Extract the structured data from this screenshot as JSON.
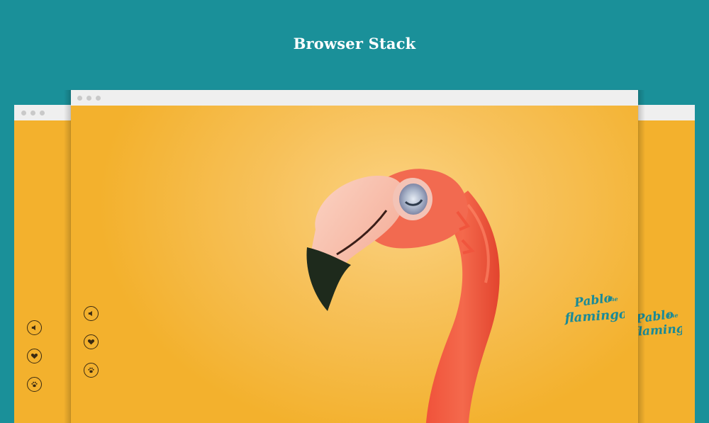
{
  "page": {
    "title": "Browser Stack"
  },
  "colors": {
    "background": "#1a9099",
    "browser_chrome": "#efefef",
    "viewport": "#f3b12d",
    "logo": "#1a8a97",
    "icon_stroke": "#3a2a12"
  },
  "browser_windows": [
    {
      "name": "back-left-window",
      "chrome_dots": 3
    },
    {
      "name": "front-window",
      "chrome_dots": 3
    },
    {
      "name": "back-right-window",
      "chrome_dots": 3
    }
  ],
  "controls": [
    {
      "name": "sound-button",
      "icon": "speaker-icon"
    },
    {
      "name": "like-button",
      "icon": "heart-icon"
    },
    {
      "name": "paw-button",
      "icon": "paw-icon"
    }
  ],
  "logo": {
    "text_line1": "Pablo",
    "text_small": "the",
    "text_line2": "flamingo"
  },
  "illustration": {
    "subject": "flamingo-head"
  }
}
